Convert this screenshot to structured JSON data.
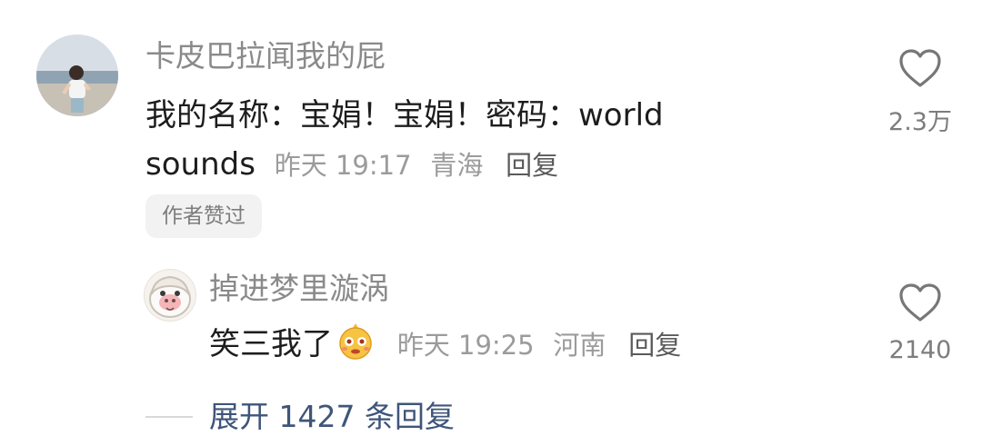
{
  "comment": {
    "username": "卡皮巴拉闻我的屁",
    "text_line1": "我的名称：宝娟！宝娟！密码：world",
    "text_line2_start": "sounds",
    "time": "昨天 19:17",
    "location": "青海",
    "reply_label": "回复",
    "author_badge": "作者赞过",
    "like_count": "2.3万"
  },
  "reply": {
    "username": "掉进梦里漩涡",
    "text": "笑三我了",
    "emoji": "smiling-face-emoji",
    "time": "昨天 19:25",
    "location": "河南",
    "reply_label": "回复",
    "like_count": "2140"
  },
  "expand": {
    "label": "展开 1427 条回复"
  },
  "colors": {
    "text_primary": "#1d1d1d",
    "text_secondary": "#8a8a8a",
    "link_blue": "#3f557a",
    "badge_bg": "#f2f2f2"
  }
}
